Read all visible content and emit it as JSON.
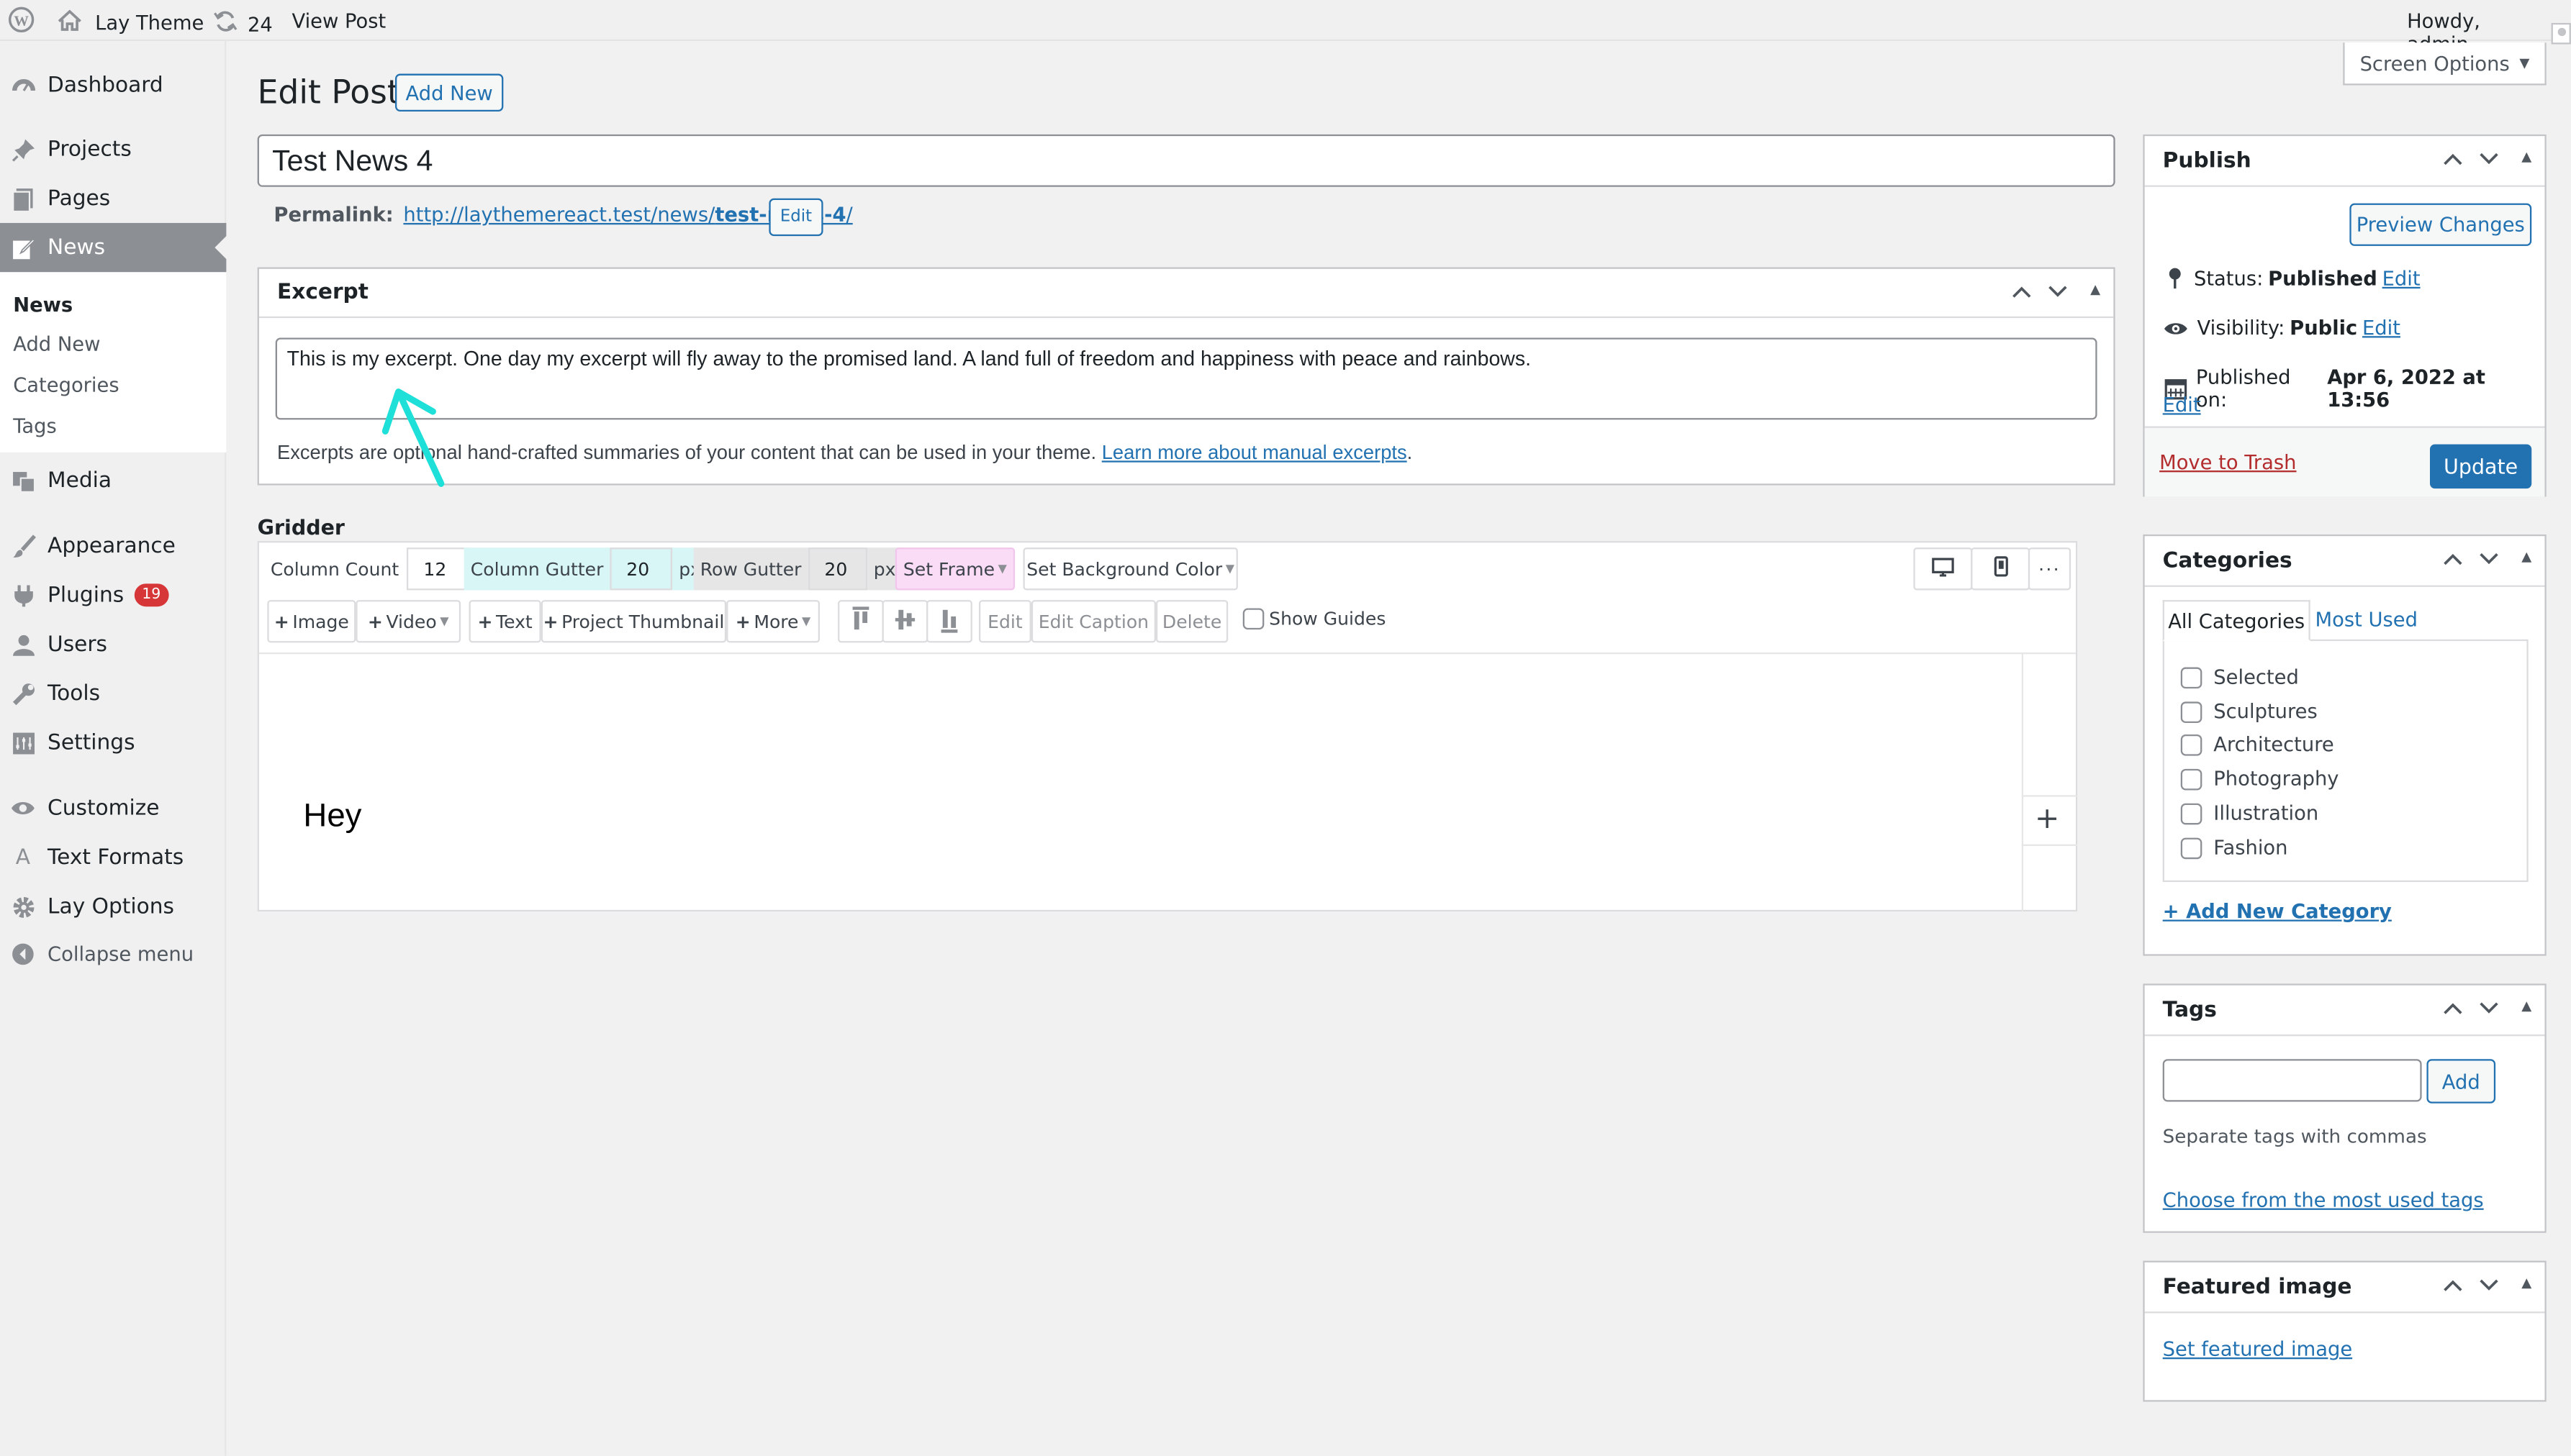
{
  "adminbar": {
    "site_name": "Lay Theme",
    "updates_count": "24",
    "view_post": "View Post",
    "howdy": "Howdy, admin"
  },
  "sidebar": {
    "items": [
      {
        "label": "Dashboard",
        "icon": "dashboard-icon"
      },
      {
        "label": "Projects",
        "icon": "pin-icon"
      },
      {
        "label": "Pages",
        "icon": "pages-icon"
      },
      {
        "label": "News",
        "icon": "news-icon",
        "active": true
      },
      {
        "label": "Media",
        "icon": "media-icon"
      },
      {
        "label": "Appearance",
        "icon": "brush-icon"
      },
      {
        "label": "Plugins",
        "icon": "plugin-icon",
        "badge": "19"
      },
      {
        "label": "Users",
        "icon": "users-icon"
      },
      {
        "label": "Tools",
        "icon": "wrench-icon"
      },
      {
        "label": "Settings",
        "icon": "settings-icon"
      },
      {
        "label": "Customize",
        "icon": "eye-icon"
      },
      {
        "label": "Text Formats",
        "icon": "letter-icon"
      },
      {
        "label": "Lay Options",
        "icon": "gear-icon"
      },
      {
        "label": "Collapse menu",
        "icon": "collapse-icon"
      }
    ],
    "submenu": [
      "News",
      "Add New",
      "Categories",
      "Tags"
    ]
  },
  "page": {
    "title": "Edit Post",
    "add_new": "Add New",
    "screen_options": "Screen Options",
    "post_title": "Test News 4"
  },
  "permalink": {
    "label": "Permalink:",
    "url_prefix": "http://laythemereact.test/news/",
    "slug": "test-news-4",
    "url_suffix": "/",
    "edit": "Edit"
  },
  "excerpt": {
    "heading": "Excerpt",
    "text": "This is my excerpt. One day my excerpt will fly away to the promised land. A land full of freedom and happiness with peace and rainbows.",
    "help_before": "Excerpts are optional hand-crafted summaries of your content that can be used in your theme.",
    "help_link": "Learn more about manual excerpts",
    "help_after": "."
  },
  "gridder": {
    "heading": "Gridder",
    "column_count_label": "Column Count",
    "column_count": "12",
    "column_gutter_label": "Column Gutter",
    "column_gutter": "20",
    "px1": "px",
    "row_gutter_label": "Row Gutter",
    "row_gutter": "20",
    "px2": "px",
    "set_frame": "Set Frame",
    "set_bg": "Set Background Color",
    "add_image": "Image",
    "add_video": "Video",
    "add_text": "Text",
    "add_project_thumbnail": "Project Thumbnail",
    "more": "More",
    "edit": "Edit",
    "edit_caption": "Edit Caption",
    "delete": "Delete",
    "show_guides": "Show Guides",
    "canvas_text": "Hey",
    "add_row": "+"
  },
  "publish": {
    "heading": "Publish",
    "preview": "Preview Changes",
    "status_label": "Status:",
    "status_value": "Published",
    "status_edit": "Edit",
    "visibility_label": "Visibility:",
    "visibility_value": "Public",
    "visibility_edit": "Edit",
    "published_label": "Published on:",
    "published_value": "Apr 6, 2022 at 13:56",
    "published_edit": "Edit",
    "trash": "Move to Trash",
    "update": "Update"
  },
  "categories": {
    "heading": "Categories",
    "tab_all": "All Categories",
    "tab_most": "Most Used",
    "items": [
      "Selected",
      "Sculptures",
      "Architecture",
      "Photography",
      "Illustration",
      "Fashion"
    ],
    "add_new": "+ Add New Category"
  },
  "tags": {
    "heading": "Tags",
    "add": "Add",
    "hint": "Separate tags with commas",
    "choose": "Choose from the most used tags"
  },
  "featured": {
    "heading": "Featured image",
    "set": "Set featured image"
  },
  "colors": {
    "accent": "#2271b1",
    "active_menu": "#8c8f94",
    "update_button": "#2271b1",
    "arrow_annotation": "#1fe0d8",
    "column_gutter_bg": "#d9f6f7",
    "row_gutter_bg": "#e6e6e6",
    "set_frame_bg": "#fbdcf7"
  }
}
